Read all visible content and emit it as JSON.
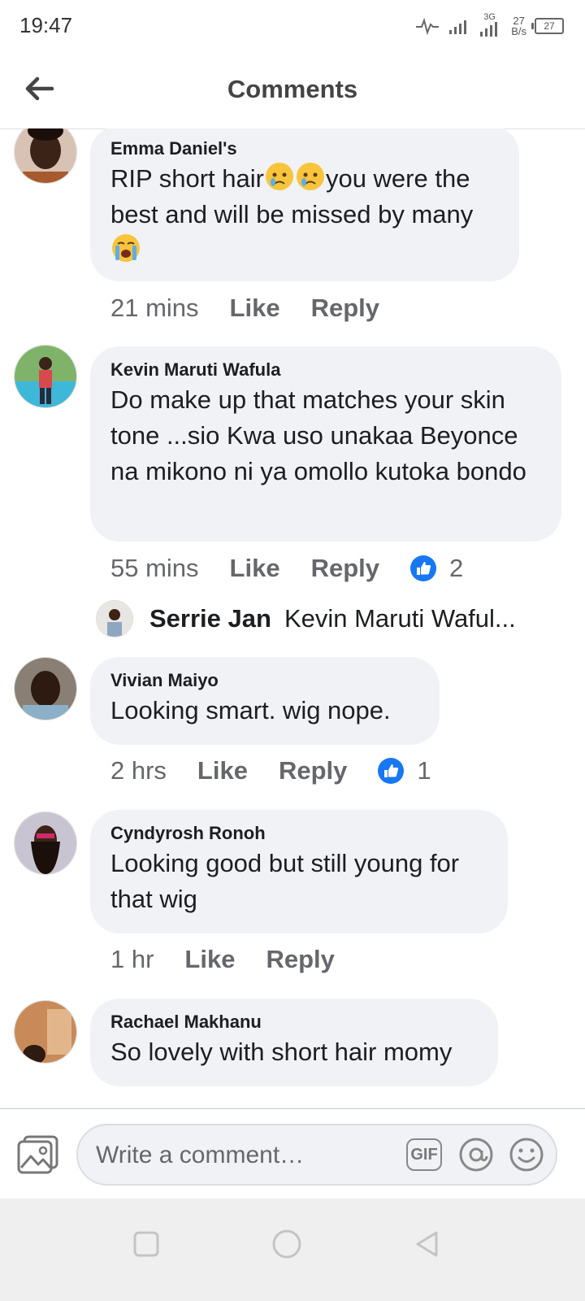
{
  "status_bar": {
    "time": "19:47",
    "network_type": "3G",
    "speed_value": "27",
    "speed_unit": "B/s",
    "battery": "27"
  },
  "header": {
    "title": "Comments"
  },
  "comments": [
    {
      "author": "Emma Daniel's",
      "text_1": "RIP short hair",
      "text_2": "you were the best and will   be missed by many",
      "time": "21 mins",
      "like": "Like",
      "reply": "Reply"
    },
    {
      "author": "Kevin Maruti Wafula",
      "text": "Do make up that matches your skin tone ...sio Kwa uso unakaa Beyonce na mikono ni ya omollo kutoka bondo",
      "time": "55 mins",
      "like": "Like",
      "reply": "Reply",
      "reactions": "2",
      "reply_preview": {
        "author": "Serrie Jan",
        "text": "Kevin Maruti Waful..."
      }
    },
    {
      "author": "Vivian Maiyo",
      "text": "Looking  smart. wig nope.",
      "time": "2 hrs",
      "like": "Like",
      "reply": "Reply",
      "reactions": "1"
    },
    {
      "author": "Cyndyrosh Ronoh",
      "text": "Looking good but still young for that wig",
      "time": "1 hr",
      "like": "Like",
      "reply": "Reply"
    },
    {
      "author": "Rachael Makhanu",
      "text": "So lovely with short hair momy"
    }
  ],
  "composer": {
    "placeholder": "Write a comment…",
    "gif_label": "GIF"
  },
  "colors": {
    "bubble": "#f0f2f5",
    "like_blue": "#1877f2",
    "secondary_text": "#65676b"
  }
}
